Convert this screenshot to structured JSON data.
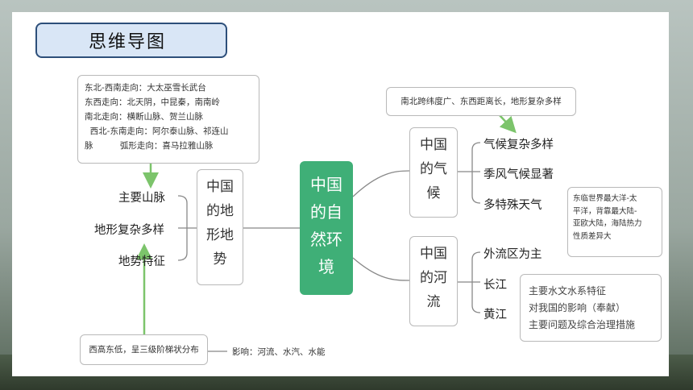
{
  "title": "思维导图",
  "left_top_note": [
    "东北-西南走向：大太巫雪长武台",
    "东西走向：北天阴，中昆秦，南南岭",
    "南北走向：横断山脉、贺兰山脉",
    "  西北-东南走向：阿尔泰山脉、祁连山",
    "脉          弧形走向：喜马拉雅山脉"
  ],
  "left_branches": [
    "主要山脉",
    "地形复杂多样",
    "地势特征"
  ],
  "terrain_node": [
    "中国",
    "的地",
    "形地",
    "势"
  ],
  "central_node": [
    "中国",
    "的自",
    "然环",
    "境"
  ],
  "bottom_note": "西高东低，呈三级阶梯状分布",
  "bottom_influence": "影响：河流、水汽、水能",
  "climate_top_note": "南北跨纬度广、东西距离长，地形复杂多样",
  "climate_node": [
    "中国",
    "的气",
    "候"
  ],
  "climate_branches": [
    "气候复杂多样",
    "季风气候显著",
    "多特殊天气"
  ],
  "climate_side_note": [
    "东临世界最大洋-太",
    "平洋，背靠最大陆-",
    "亚欧大陆，海陆热力",
    "性质差异大"
  ],
  "river_node": [
    "中国",
    "的河",
    "流"
  ],
  "river_branches": [
    "外流区为主",
    "长江",
    "黄江"
  ],
  "river_side_note": [
    "主要水文水系特征",
    "对我国的影响（奉献）",
    "主要问题及综合治理措施"
  ],
  "colors": {
    "accent_green": "#3faf77",
    "arrow_green": "#7cc46b",
    "title_border": "#2d4f7a",
    "title_fill": "#d9e6f6"
  }
}
